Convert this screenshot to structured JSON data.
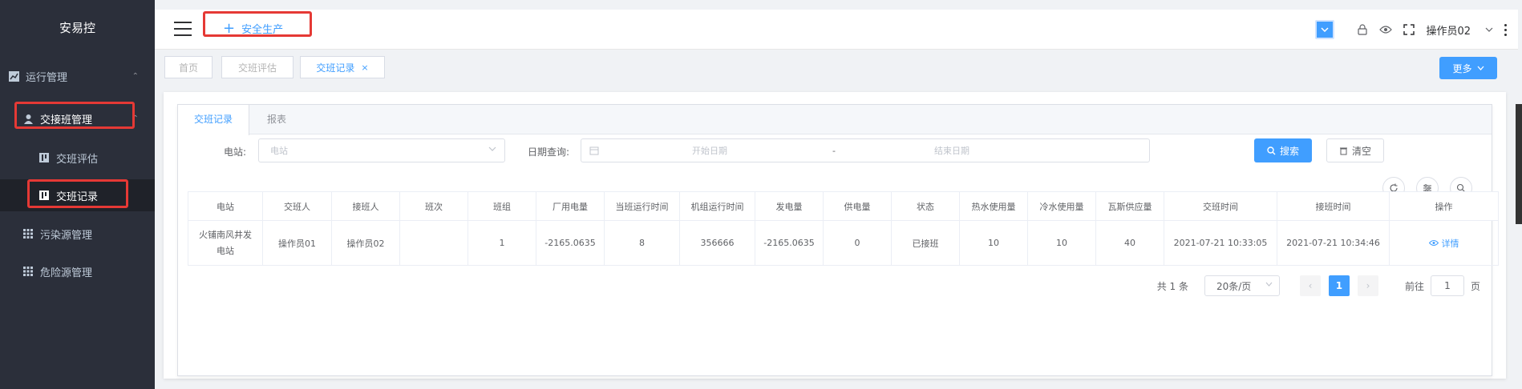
{
  "sidebar": {
    "brand": "安易控",
    "items": [
      {
        "label": "运行管理",
        "icon": "chart-icon",
        "caret": "⌃"
      },
      {
        "label": "交接班管理",
        "icon": "user-icon",
        "caret": "⌃"
      },
      {
        "label": "交班评估",
        "icon": "report-icon"
      },
      {
        "label": "交班记录",
        "icon": "report-icon"
      },
      {
        "label": "污染源管理",
        "icon": "grid-icon"
      },
      {
        "label": "危险源管理",
        "icon": "grid-icon"
      }
    ]
  },
  "topbar": {
    "module_tab": "安全生产",
    "user": "操作员02"
  },
  "tagsbar": {
    "tags": [
      "首页",
      "交班评估",
      "交班记录"
    ],
    "more": "更多"
  },
  "main": {
    "tabs": [
      "交班记录",
      "报表"
    ],
    "filters": {
      "station_label": "电站:",
      "station_placeholder": "电站",
      "date_label": "日期查询:",
      "start_placeholder": "开始日期",
      "sep": "-",
      "end_placeholder": "结束日期",
      "search": "搜索",
      "clear": "清空"
    },
    "table": {
      "columns": [
        "电站",
        "交班人",
        "接班人",
        "班次",
        "班组",
        "厂用电量",
        "当班运行时间",
        "机组运行时间",
        "发电量",
        "供电量",
        "状态",
        "热水使用量",
        "冷水使用量",
        "瓦斯供应量",
        "交班时间",
        "接班时间",
        "操作"
      ],
      "rows": [
        {
          "station": "火铺南风井发电站",
          "handover": "操作员01",
          "receiver": "操作员02",
          "shift": "",
          "team": "1",
          "plant_power": "-2165.0635",
          "shift_run_time": "8",
          "unit_run_time": "356666",
          "generation": "-2165.0635",
          "supply": "0",
          "status": "已接班",
          "hot_water": "10",
          "cold_water": "10",
          "gas": "40",
          "handover_time": "2021-07-21 10:33:05",
          "receive_time": "2021-07-21 10:34:46",
          "action": "详情"
        }
      ]
    },
    "pager": {
      "total": "共 1 条",
      "page_size": "20条/页",
      "prev": "‹",
      "current": "1",
      "next": "›",
      "goto": "前往",
      "goto_value": "1",
      "page_unit": "页"
    }
  },
  "colors": {
    "accent": "#409eff",
    "sidebar_bg": "#2b2f3a",
    "highlight": "#e53935"
  }
}
